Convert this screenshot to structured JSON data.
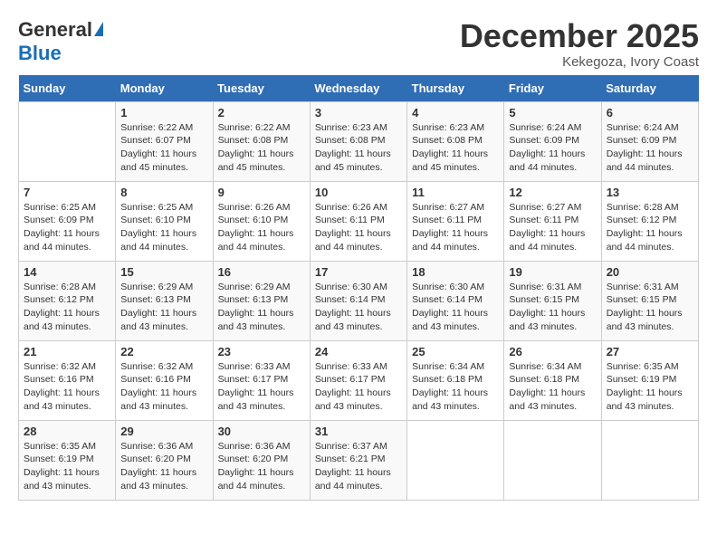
{
  "header": {
    "logo_general": "General",
    "logo_blue": "Blue",
    "month_title": "December 2025",
    "location": "Kekegoza, Ivory Coast"
  },
  "weekdays": [
    "Sunday",
    "Monday",
    "Tuesday",
    "Wednesday",
    "Thursday",
    "Friday",
    "Saturday"
  ],
  "weeks": [
    [
      {
        "day": "",
        "sunrise": "",
        "sunset": "",
        "daylight": ""
      },
      {
        "day": "1",
        "sunrise": "Sunrise: 6:22 AM",
        "sunset": "Sunset: 6:07 PM",
        "daylight": "Daylight: 11 hours and 45 minutes."
      },
      {
        "day": "2",
        "sunrise": "Sunrise: 6:22 AM",
        "sunset": "Sunset: 6:08 PM",
        "daylight": "Daylight: 11 hours and 45 minutes."
      },
      {
        "day": "3",
        "sunrise": "Sunrise: 6:23 AM",
        "sunset": "Sunset: 6:08 PM",
        "daylight": "Daylight: 11 hours and 45 minutes."
      },
      {
        "day": "4",
        "sunrise": "Sunrise: 6:23 AM",
        "sunset": "Sunset: 6:08 PM",
        "daylight": "Daylight: 11 hours and 45 minutes."
      },
      {
        "day": "5",
        "sunrise": "Sunrise: 6:24 AM",
        "sunset": "Sunset: 6:09 PM",
        "daylight": "Daylight: 11 hours and 44 minutes."
      },
      {
        "day": "6",
        "sunrise": "Sunrise: 6:24 AM",
        "sunset": "Sunset: 6:09 PM",
        "daylight": "Daylight: 11 hours and 44 minutes."
      }
    ],
    [
      {
        "day": "7",
        "sunrise": "Sunrise: 6:25 AM",
        "sunset": "Sunset: 6:09 PM",
        "daylight": "Daylight: 11 hours and 44 minutes."
      },
      {
        "day": "8",
        "sunrise": "Sunrise: 6:25 AM",
        "sunset": "Sunset: 6:10 PM",
        "daylight": "Daylight: 11 hours and 44 minutes."
      },
      {
        "day": "9",
        "sunrise": "Sunrise: 6:26 AM",
        "sunset": "Sunset: 6:10 PM",
        "daylight": "Daylight: 11 hours and 44 minutes."
      },
      {
        "day": "10",
        "sunrise": "Sunrise: 6:26 AM",
        "sunset": "Sunset: 6:11 PM",
        "daylight": "Daylight: 11 hours and 44 minutes."
      },
      {
        "day": "11",
        "sunrise": "Sunrise: 6:27 AM",
        "sunset": "Sunset: 6:11 PM",
        "daylight": "Daylight: 11 hours and 44 minutes."
      },
      {
        "day": "12",
        "sunrise": "Sunrise: 6:27 AM",
        "sunset": "Sunset: 6:11 PM",
        "daylight": "Daylight: 11 hours and 44 minutes."
      },
      {
        "day": "13",
        "sunrise": "Sunrise: 6:28 AM",
        "sunset": "Sunset: 6:12 PM",
        "daylight": "Daylight: 11 hours and 44 minutes."
      }
    ],
    [
      {
        "day": "14",
        "sunrise": "Sunrise: 6:28 AM",
        "sunset": "Sunset: 6:12 PM",
        "daylight": "Daylight: 11 hours and 43 minutes."
      },
      {
        "day": "15",
        "sunrise": "Sunrise: 6:29 AM",
        "sunset": "Sunset: 6:13 PM",
        "daylight": "Daylight: 11 hours and 43 minutes."
      },
      {
        "day": "16",
        "sunrise": "Sunrise: 6:29 AM",
        "sunset": "Sunset: 6:13 PM",
        "daylight": "Daylight: 11 hours and 43 minutes."
      },
      {
        "day": "17",
        "sunrise": "Sunrise: 6:30 AM",
        "sunset": "Sunset: 6:14 PM",
        "daylight": "Daylight: 11 hours and 43 minutes."
      },
      {
        "day": "18",
        "sunrise": "Sunrise: 6:30 AM",
        "sunset": "Sunset: 6:14 PM",
        "daylight": "Daylight: 11 hours and 43 minutes."
      },
      {
        "day": "19",
        "sunrise": "Sunrise: 6:31 AM",
        "sunset": "Sunset: 6:15 PM",
        "daylight": "Daylight: 11 hours and 43 minutes."
      },
      {
        "day": "20",
        "sunrise": "Sunrise: 6:31 AM",
        "sunset": "Sunset: 6:15 PM",
        "daylight": "Daylight: 11 hours and 43 minutes."
      }
    ],
    [
      {
        "day": "21",
        "sunrise": "Sunrise: 6:32 AM",
        "sunset": "Sunset: 6:16 PM",
        "daylight": "Daylight: 11 hours and 43 minutes."
      },
      {
        "day": "22",
        "sunrise": "Sunrise: 6:32 AM",
        "sunset": "Sunset: 6:16 PM",
        "daylight": "Daylight: 11 hours and 43 minutes."
      },
      {
        "day": "23",
        "sunrise": "Sunrise: 6:33 AM",
        "sunset": "Sunset: 6:17 PM",
        "daylight": "Daylight: 11 hours and 43 minutes."
      },
      {
        "day": "24",
        "sunrise": "Sunrise: 6:33 AM",
        "sunset": "Sunset: 6:17 PM",
        "daylight": "Daylight: 11 hours and 43 minutes."
      },
      {
        "day": "25",
        "sunrise": "Sunrise: 6:34 AM",
        "sunset": "Sunset: 6:18 PM",
        "daylight": "Daylight: 11 hours and 43 minutes."
      },
      {
        "day": "26",
        "sunrise": "Sunrise: 6:34 AM",
        "sunset": "Sunset: 6:18 PM",
        "daylight": "Daylight: 11 hours and 43 minutes."
      },
      {
        "day": "27",
        "sunrise": "Sunrise: 6:35 AM",
        "sunset": "Sunset: 6:19 PM",
        "daylight": "Daylight: 11 hours and 43 minutes."
      }
    ],
    [
      {
        "day": "28",
        "sunrise": "Sunrise: 6:35 AM",
        "sunset": "Sunset: 6:19 PM",
        "daylight": "Daylight: 11 hours and 43 minutes."
      },
      {
        "day": "29",
        "sunrise": "Sunrise: 6:36 AM",
        "sunset": "Sunset: 6:20 PM",
        "daylight": "Daylight: 11 hours and 43 minutes."
      },
      {
        "day": "30",
        "sunrise": "Sunrise: 6:36 AM",
        "sunset": "Sunset: 6:20 PM",
        "daylight": "Daylight: 11 hours and 44 minutes."
      },
      {
        "day": "31",
        "sunrise": "Sunrise: 6:37 AM",
        "sunset": "Sunset: 6:21 PM",
        "daylight": "Daylight: 11 hours and 44 minutes."
      },
      {
        "day": "",
        "sunrise": "",
        "sunset": "",
        "daylight": ""
      },
      {
        "day": "",
        "sunrise": "",
        "sunset": "",
        "daylight": ""
      },
      {
        "day": "",
        "sunrise": "",
        "sunset": "",
        "daylight": ""
      }
    ]
  ]
}
